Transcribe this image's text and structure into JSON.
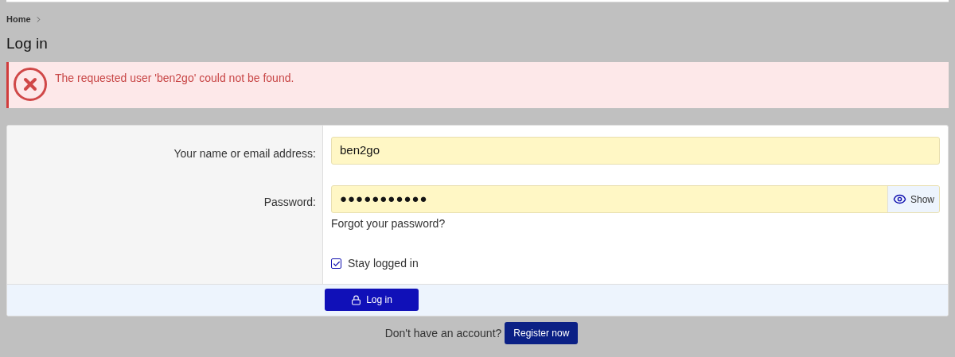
{
  "breadcrumb": [
    {
      "label": "Home"
    }
  ],
  "title": "Log in",
  "error": {
    "message": "The requested user 'ben2go' could not be found."
  },
  "form": {
    "fields": [
      {
        "kind": "text",
        "label": "Your name or email address:",
        "value": "ben2go"
      },
      {
        "kind": "password",
        "label": "Password:",
        "value": "●●●●●●●●●●●",
        "toggle": "Show",
        "link": "Forgot your password?"
      }
    ],
    "remember": {
      "label": "Stay logged in",
      "checked": true
    },
    "submit": "Log in"
  },
  "footer": {
    "text": "Don't have an account?",
    "button": "Register now"
  }
}
